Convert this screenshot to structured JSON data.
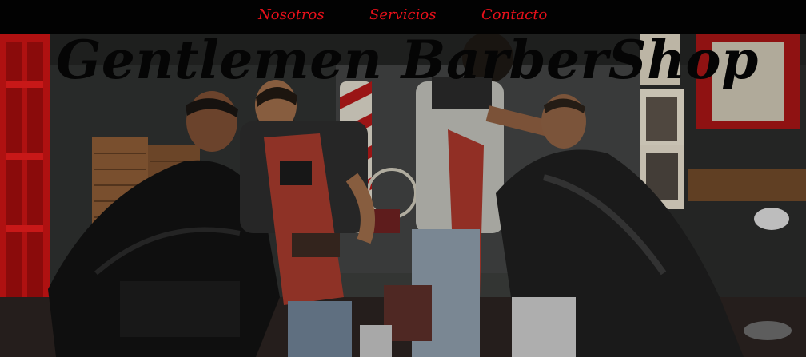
{
  "nav": {
    "items": [
      {
        "label": "Nosotros"
      },
      {
        "label": "Servicios"
      },
      {
        "label": "Contacto"
      }
    ],
    "link_color": "#e8101a",
    "background": "#020202"
  },
  "hero": {
    "title": "Gentlemen BarberShop",
    "image": "barbershop-interior-photo"
  }
}
